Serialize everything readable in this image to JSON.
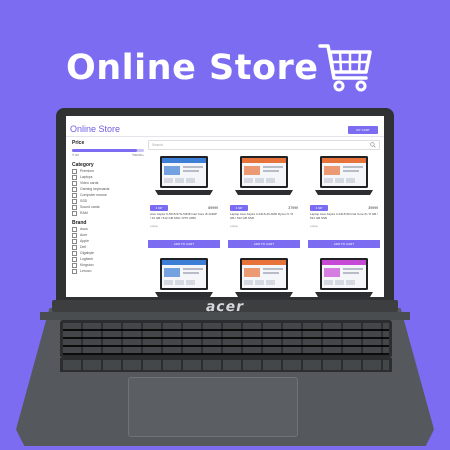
{
  "hero": {
    "title": "Online Store"
  },
  "laptop": {
    "brand": "acer"
  },
  "store": {
    "logo": "Online Store",
    "cart_button": "MY CART",
    "search_placeholder": "Search",
    "sidebar": {
      "price_heading": "Price",
      "price_min": "₹ 0/0",
      "price_max": "₹00000+",
      "price_fill_fraction": 0.9,
      "category_heading": "Category",
      "categories": [
        "Premium",
        "Laptops",
        "Video cards",
        "Gaming keyboards",
        "Computer mouse",
        "SSD",
        "Sound cards",
        "RAM"
      ],
      "brand_heading": "Brand",
      "brands": [
        "Asus",
        "Acer",
        "Apple",
        "Dell",
        "Gigabyte",
        "Logitech",
        "Kingston",
        "Lenovo"
      ]
    },
    "products": [
      {
        "tag": "1 GP",
        "price": "89999",
        "title": "Acer Aspire 5 A515-57G-53N8 Intel Core i5-1240P / 16 GB / 512 GB SSD / RTX 2050",
        "subtitle": "Laptop",
        "button": "ADD TO CART",
        "screen_color": "#3d7fd6"
      },
      {
        "tag": "1 GP",
        "price": "37999",
        "title": "Laptop Acer Aspire 3 A315-43 AMD Ryzen 5 / 8 GB / 512 GB SSD",
        "subtitle": "Laptop",
        "button": "ADD TO CART",
        "screen_color": "#e8733a"
      },
      {
        "tag": "1 GP",
        "price": "39999",
        "title": "Laptop Acer Aspire 3 A315-59 Intel Core i5 / 8 GB / 512 GB SSD",
        "subtitle": "Laptop",
        "button": "ADD TO CART",
        "screen_color": "#e8733a"
      },
      {
        "tag": "",
        "price": "",
        "title": "",
        "subtitle": "",
        "button": "",
        "screen_color": "#3d7fd6"
      },
      {
        "tag": "",
        "price": "",
        "title": "",
        "subtitle": "",
        "button": "",
        "screen_color": "#e8733a"
      },
      {
        "tag": "",
        "price": "",
        "title": "",
        "subtitle": "",
        "button": "",
        "screen_color": "#c74ad6"
      }
    ]
  },
  "colors": {
    "accent": "#7b6cf2",
    "background": "#7b6cf2"
  },
  "icons": {
    "cart": "shopping-cart-icon",
    "search": "search-icon"
  }
}
